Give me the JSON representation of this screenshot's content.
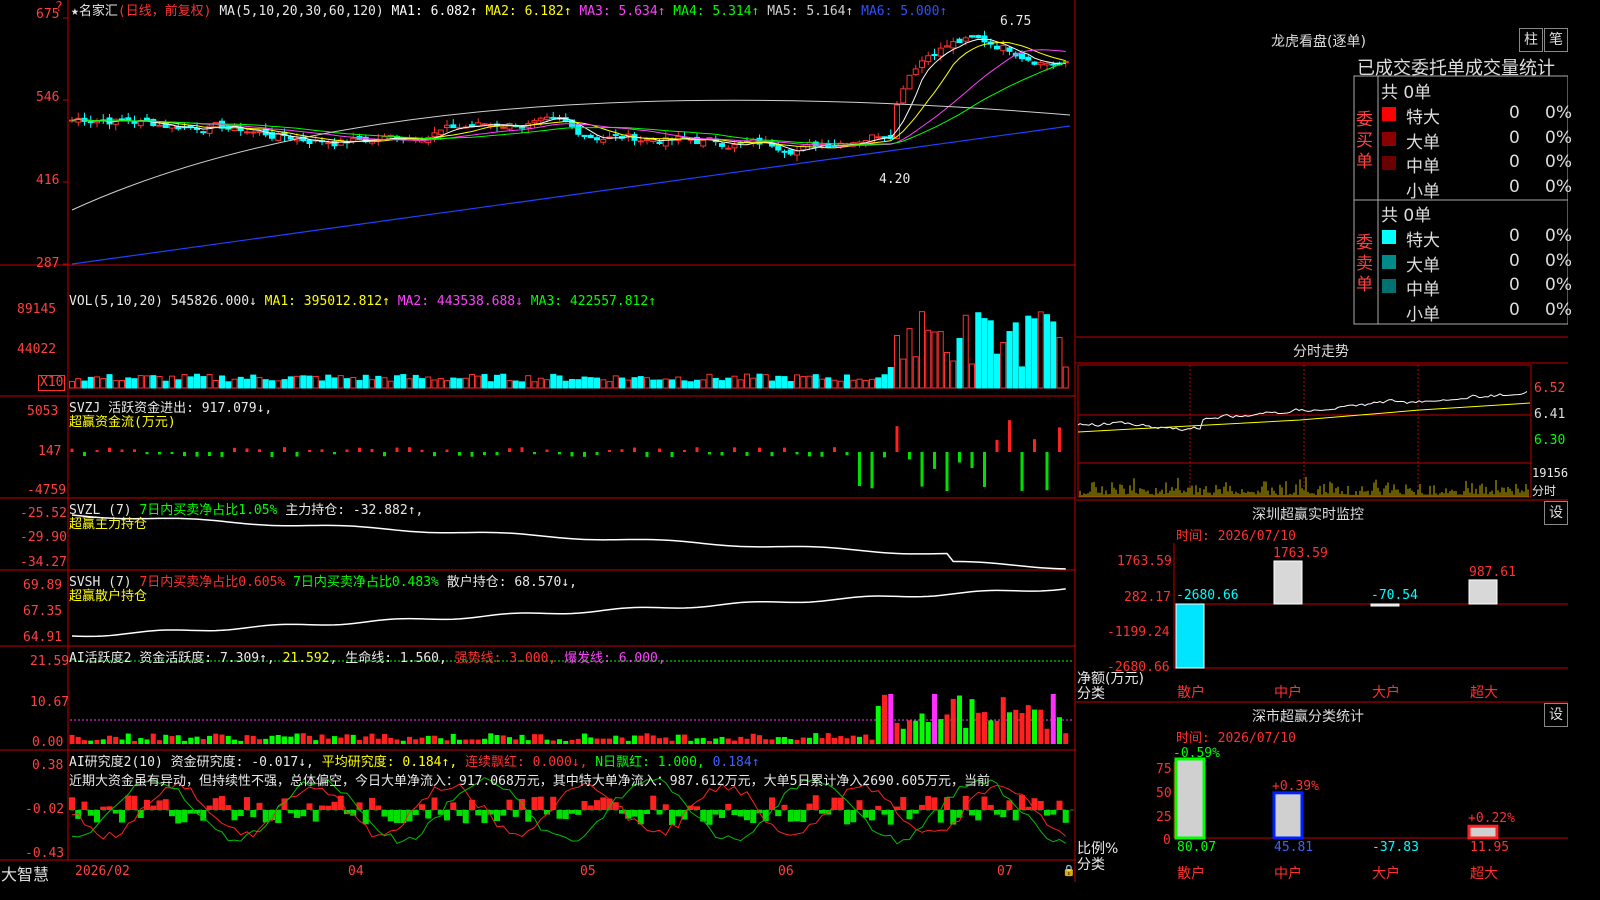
{
  "stock": {
    "name": "名家汇",
    "period_note": "(日线，前复权)"
  },
  "main_panel": {
    "ma_prefix": "MA(5,10,20,30,60,120)",
    "mas": [
      {
        "label": "MA1: 6.082↑",
        "color": "#ffffff"
      },
      {
        "label": "MA2: 6.182↑",
        "color": "#ffff00"
      },
      {
        "label": "MA3: 5.634↑",
        "color": "#ff40ff"
      },
      {
        "label": "MA4: 5.314↑",
        "color": "#00ff00"
      },
      {
        "label": "MA5: 5.164↑",
        "color": "#d0d0d0"
      },
      {
        "label": "MA6: 5.000↑",
        "color": "#3050ff"
      }
    ],
    "y_ticks": [
      "675",
      "546",
      "416",
      "287"
    ],
    "high_label": "6.75",
    "low_label": "4.20"
  },
  "vol_panel": {
    "prefix": "VOL(5,10,20)",
    "value": "545826.000↓",
    "mas": [
      {
        "label": "MA1: 395012.812↑",
        "color": "#ffff00"
      },
      {
        "label": "MA2: 443538.688↓",
        "color": "#ff40ff"
      },
      {
        "label": "MA3: 422557.812↑",
        "color": "#00ff00"
      }
    ],
    "y_ticks": [
      "89145",
      "44022"
    ],
    "unit": "X10"
  },
  "svzj_panel": {
    "line1": "SVZJ  活跃资金进出: 917.079↓,",
    "line2": "超赢资金流(万元)",
    "y_ticks": [
      "5053",
      "147",
      "-4759"
    ]
  },
  "svzl_panel": {
    "prefix": "SVZL (7) ",
    "green_text": "7日内买卖净占比1.05%",
    "white_text": " 主力持仓: -32.882↑,",
    "line2": "超赢主力持仓",
    "y_ticks": [
      "-25.52",
      "-29.90",
      "-34.27"
    ]
  },
  "svsh_panel": {
    "prefix": "SVSH (7) ",
    "red_text": "7日内买卖净占比0.605%",
    "green_text": " 7日内买卖净占比0.483%",
    "white_text": " 散户持仓: 68.570↓,",
    "line2": "超赢散户持仓",
    "y_ticks": [
      "69.89",
      "67.35",
      "64.91"
    ]
  },
  "ai_active_panel": {
    "prefix": "AI活跃度2 资金活跃度: 7.309↑, ",
    "v2": "21.592",
    "v3": ", 生命线: 1.560, ",
    "v4": "强势线: 3.000, ",
    "v5": "爆发线: 6.000,",
    "y_ticks": [
      "21.59",
      "10.67",
      "0.00"
    ]
  },
  "ai_research_panel": {
    "prefix": "AI研究度2(10) 资金研究度: -0.017↓, ",
    "v2": "平均研究度: 0.184↑, ",
    "v3": "连续飘红: 0.000↓, ",
    "v4": "N日飘红: 1.000, ",
    "v5": "0.184↑",
    "desc": "近期大资金虽有异动，但持续性不强，总体偏空，今日大单净流入：917.068万元，其中特大单净流入：987.612万元，大单5日累计净入2690.605万元，当前",
    "y_ticks": [
      "0.38",
      "-0.02",
      "-0.43"
    ]
  },
  "x_axis": {
    "labels": [
      "2026/02",
      "04",
      "05",
      "06",
      "07"
    ],
    "brand": "大智慧"
  },
  "right_panel": {
    "lhb_title": "龙虎看盘(逐单)",
    "btn1": "柱",
    "btn2": "笔",
    "stats_title": "已成交委托单成交量统计",
    "buy_label": "委买单",
    "sell_label": "委卖单",
    "buy_total": "共 0单",
    "sell_total": "共 0单",
    "buy_rows": [
      {
        "name": "特大",
        "count": "0",
        "pct": "0%",
        "color": "#ff0000"
      },
      {
        "name": "大单",
        "count": "0",
        "pct": "0%",
        "color": "#8b0000"
      },
      {
        "name": "中单",
        "count": "0",
        "pct": "0%",
        "color": "#6b0000"
      },
      {
        "name": "小单",
        "count": "0",
        "pct": "0%",
        "color": ""
      }
    ],
    "sell_rows": [
      {
        "name": "特大",
        "count": "0",
        "pct": "0%",
        "color": "#00ffff"
      },
      {
        "name": "大单",
        "count": "0",
        "pct": "0%",
        "color": "#008b8b"
      },
      {
        "name": "中单",
        "count": "0",
        "pct": "0%",
        "color": "#007070"
      },
      {
        "name": "小单",
        "count": "0",
        "pct": "0%",
        "color": ""
      }
    ],
    "intraday_title": "分时走势",
    "intraday_prices": [
      "6.52",
      "6.41",
      "6.30"
    ],
    "intraday_vol_top": "19156",
    "intraday_vol_unit": "分时",
    "sz_monitor_title": "深圳超赢实时监控",
    "sz_settings": "设",
    "sz_time": "时间: 2026/07/10",
    "sz_yticks": [
      "1763.59",
      "282.17",
      "-1199.24",
      "-2680.66"
    ],
    "sz_axis_label1": "净额(万元)",
    "sz_axis_label2": "分类",
    "sz_cat_labels": [
      "散户",
      "中户",
      "大户",
      "超大"
    ],
    "sz_bar_labels": [
      "-2680.66",
      "1763.59",
      "-70.54",
      "987.61"
    ],
    "cls_title": "深市超赢分类统计",
    "cls_settings": "设",
    "cls_time": "时间: 2026/07/10",
    "cls_yticks": [
      "75",
      "50",
      "25",
      "0"
    ],
    "cls_axis_label1": "比例%",
    "cls_axis_label2": "分类",
    "cls_top_labels": [
      "-0.59%",
      "+0.39%",
      "+0.22%"
    ],
    "cls_bottom_values": [
      "80.07",
      "45.81",
      "-37.83",
      "11.95"
    ],
    "cls_cat_labels": [
      "散户",
      "中户",
      "大户",
      "超大"
    ]
  },
  "chart_data": {
    "type": "bar",
    "title": "深圳超赢实时监控",
    "xlabel": "分类",
    "ylabel": "净额(万元)",
    "categories": [
      "散户",
      "中户",
      "大户",
      "超大"
    ],
    "values": [
      -2680.66,
      1763.59,
      -70.54,
      987.61
    ],
    "ylim": [
      -2680.66,
      1763.59
    ],
    "secondary": {
      "title": "深市超赢分类统计",
      "xlabel": "分类",
      "ylabel": "比例%",
      "categories": [
        "散户",
        "中户",
        "大户",
        "超大"
      ],
      "values": [
        80.07,
        45.81,
        -37.83,
        11.95
      ],
      "change_pct": [
        "-0.59%",
        "+0.39%",
        null,
        "+0.22%"
      ],
      "ylim": [
        0,
        75
      ]
    }
  }
}
